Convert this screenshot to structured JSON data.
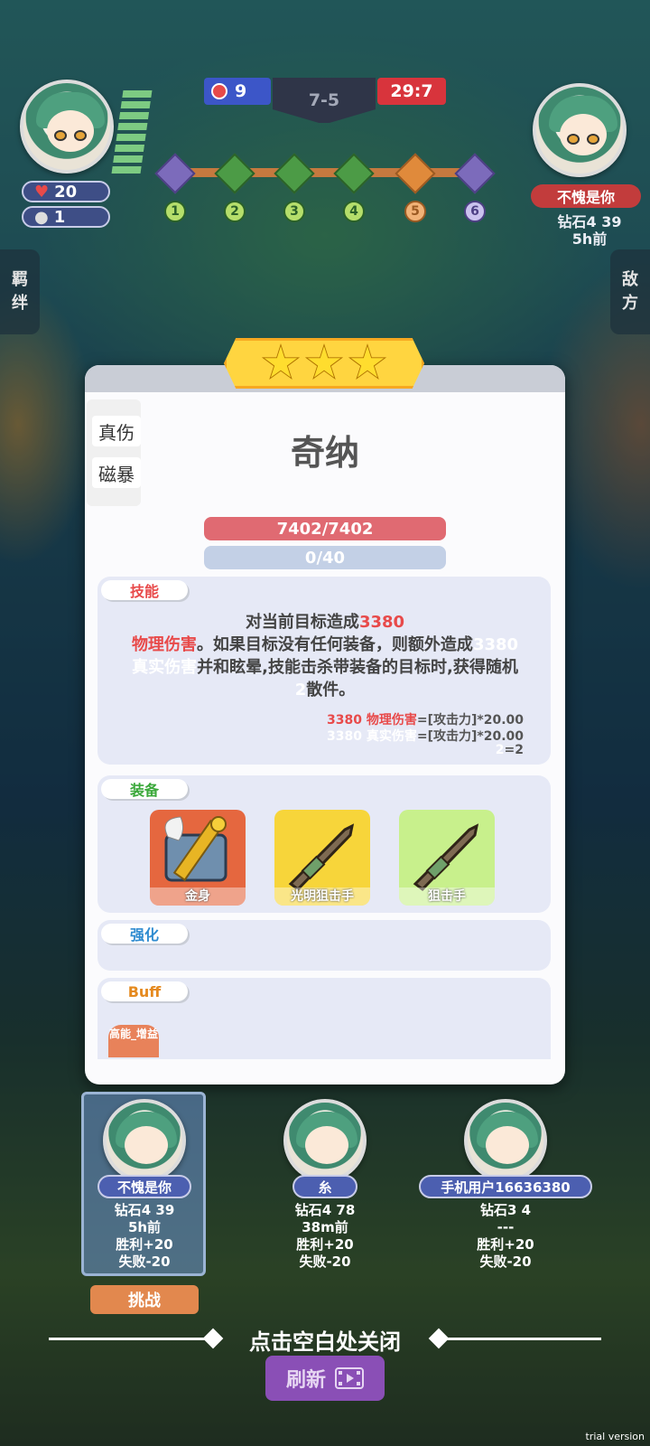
{
  "hud": {
    "self_hp": "20",
    "self_coins": "1",
    "blue_score": "9",
    "round": "7-5",
    "red_score": "29:7",
    "stages": [
      "1",
      "2",
      "3",
      "4",
      "5",
      "6"
    ],
    "opponent_name": "不愧是你",
    "opponent_rank": "钻石4 39",
    "opponent_time": "5h前",
    "left_tab": [
      "羁",
      "绊"
    ],
    "right_tab": [
      "敌",
      "方"
    ]
  },
  "modal": {
    "stars": 3,
    "tags": [
      "真伤",
      "磁暴"
    ],
    "hero_name": "奇纳",
    "hp": "7402/7402",
    "mana": "0/40",
    "skill_label": "技能",
    "skill_parts": {
      "p1": "对当前目标造成",
      "p2": "3380",
      "p3": "物理伤害",
      "p4": "。如果目标没有任何装备，则额外造成",
      "p5": "3380",
      "p6": "真实伤害",
      "p7": "并和眩晕,技能击杀带装备的目标时,获得随机",
      "p8": "2",
      "p9": "散件。"
    },
    "formula1_red": "3380 物理伤害",
    "formula1_rest": "=[攻击力]*20.00",
    "formula2_ghost": "3380 真实伤害",
    "formula2_rest": "=[攻击力]*20.00",
    "formula3_ghost": "2",
    "formula3_rest": "=2",
    "equip_label": "装备",
    "equipment": [
      "金身",
      "光明狙击手",
      "狙击手"
    ],
    "enhance_label": "强化",
    "buff_label": "Buff",
    "buff_chip": "高能_增益"
  },
  "players": [
    {
      "name": "不愧是你",
      "rank": "钻石4 39",
      "time": "5h前",
      "win": "胜利+20",
      "lose": "失败-20"
    },
    {
      "name": "糸",
      "rank": "钻石4 78",
      "time": "38m前",
      "win": "胜利+20",
      "lose": "失败-20"
    },
    {
      "name": "手机用户16636380",
      "rank": "钻石3 4",
      "time": "---",
      "win": "胜利+20",
      "lose": "失败-20"
    }
  ],
  "challenge": "挑战",
  "close_hint": "点击空白处关闭",
  "refresh": "刷新",
  "trial": "trial version",
  "colors": {
    "blue_team": "#3c56c8",
    "red_team": "#d8343c",
    "hp": "#e06a72",
    "star": "#ffd540"
  }
}
